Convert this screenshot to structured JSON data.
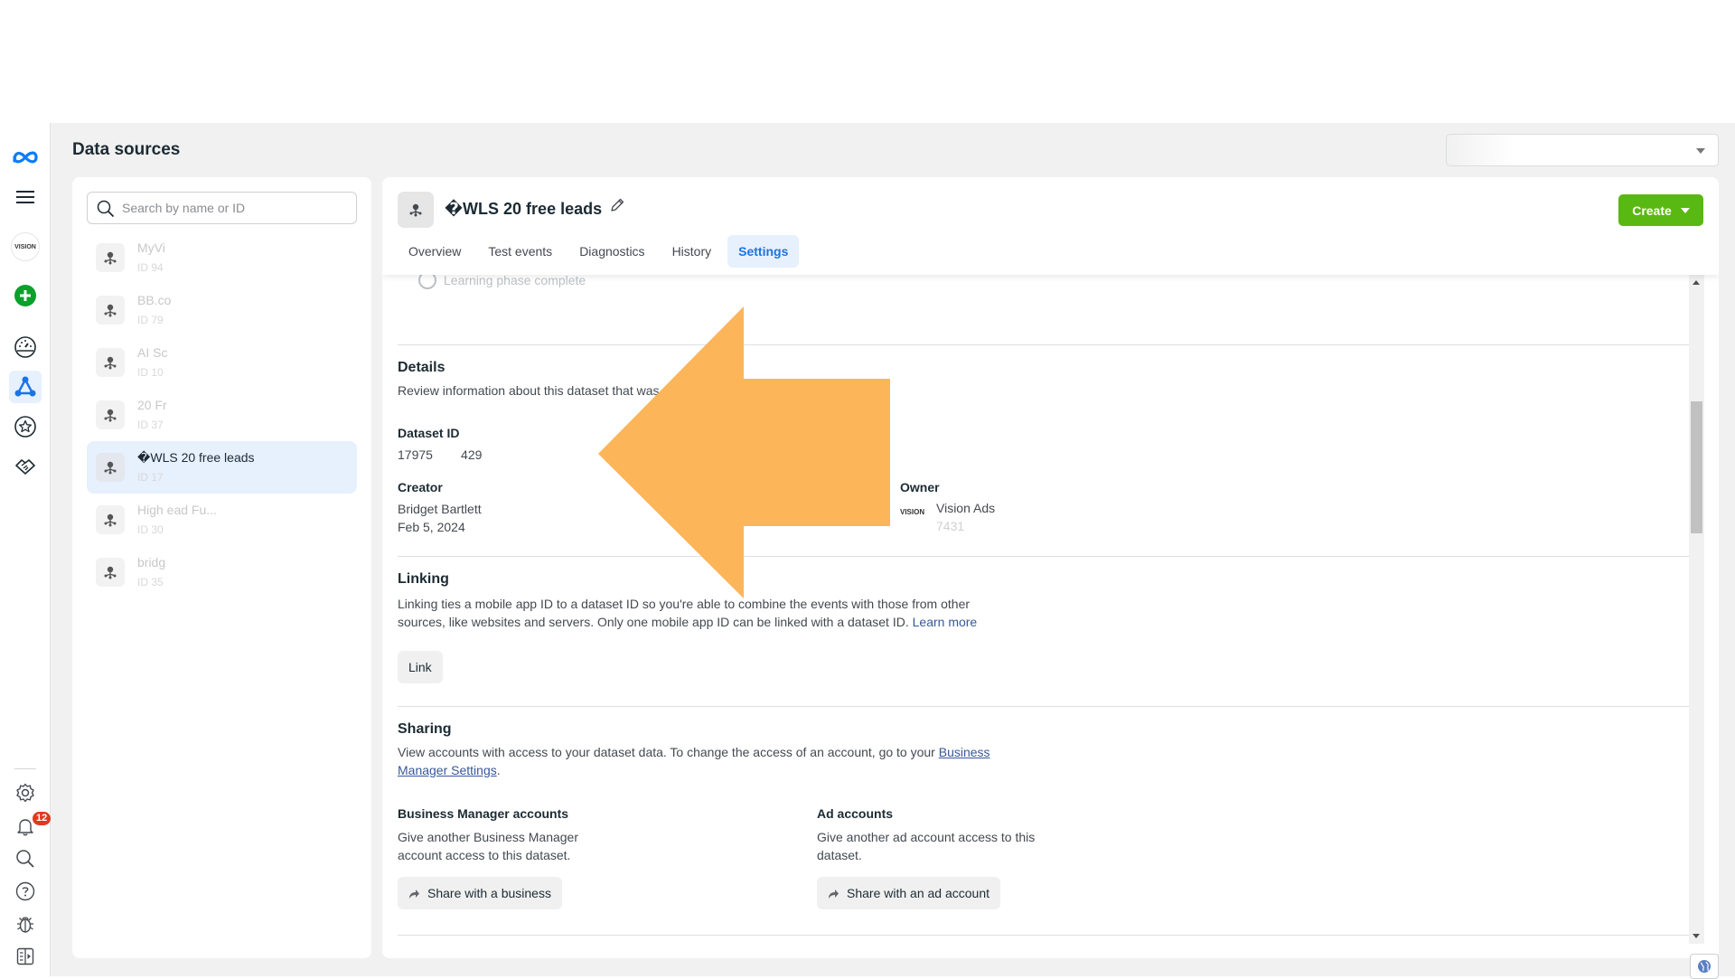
{
  "page": {
    "title": "Data sources"
  },
  "leftnav": {
    "account_logo_text": "VISION",
    "notifications_count": "12",
    "items": [
      {
        "name": "meta-logo"
      },
      {
        "name": "menu"
      },
      {
        "name": "account"
      },
      {
        "name": "create"
      },
      {
        "name": "dashboard"
      },
      {
        "name": "data-sources",
        "active": true
      },
      {
        "name": "favorites"
      },
      {
        "name": "partnerships"
      },
      {
        "name": "settings"
      },
      {
        "name": "notifications"
      },
      {
        "name": "search"
      },
      {
        "name": "help"
      },
      {
        "name": "report-bug"
      },
      {
        "name": "toggle-panel"
      }
    ]
  },
  "search": {
    "placeholder": "Search by name or ID",
    "value": ""
  },
  "datasets": [
    {
      "name": "MyVi",
      "id": "ID 94",
      "selected": false
    },
    {
      "name": "BB.co",
      "id": "ID 79",
      "selected": false
    },
    {
      "name": "AI Sc",
      "id": "ID 10",
      "selected": false
    },
    {
      "name": "20 Fr",
      "id": "ID 37",
      "selected": false
    },
    {
      "name": "�WLS 20 free leads",
      "id": "ID 17",
      "selected": true
    },
    {
      "name": "High                              ead Fu...",
      "id": "ID 30",
      "selected": false
    },
    {
      "name": "bridg",
      "id": "ID 35",
      "selected": false
    }
  ],
  "header": {
    "title": "�WLS 20 free leads",
    "create_label": "Create",
    "tabs": [
      {
        "label": "Overview",
        "active": false
      },
      {
        "label": "Test events",
        "active": false
      },
      {
        "label": "Diagnostics",
        "active": false
      },
      {
        "label": "History",
        "active": false
      },
      {
        "label": "Settings",
        "active": true
      }
    ]
  },
  "content": {
    "learning_phase": "Learning phase complete",
    "details": {
      "title": "Details",
      "description": "Review information about this dataset that was",
      "dataset_id_label": "Dataset ID",
      "dataset_id_value": "17975        429",
      "creator_label": "Creator",
      "creator_name": "Bridget Bartlett",
      "creator_date": "Feb 5, 2024",
      "owner_label": "Owner",
      "owner_logo_text": "VISION",
      "owner_name": "Vision Ads",
      "owner_id": "7431"
    },
    "linking": {
      "title": "Linking",
      "description": "Linking ties a mobile app ID to a dataset ID so you're able to combine the events with those from other sources, like websites and servers. Only one mobile app ID can be linked with a dataset ID.",
      "learn_more": "Learn more",
      "link_button": "Link"
    },
    "sharing": {
      "title": "Sharing",
      "description": "View accounts with access to your dataset data. To change the access of an account, go to your",
      "settings_link": "Business Manager Settings",
      "period": ".",
      "bm_title": "Business Manager accounts",
      "bm_description": "Give another Business Manager account access to this dataset.",
      "bm_button": "Share with a business",
      "ad_title": "Ad accounts",
      "ad_description": "Give another ad account access to this dataset.",
      "ad_button": "Share with an ad account"
    }
  },
  "annotation": {
    "type": "arrow",
    "direction": "left",
    "color": "#FDB55A"
  },
  "colors": {
    "brand_blue": "#1b74e4",
    "create_green": "#5ab812",
    "badge_red": "#e0391f",
    "selected_bg": "#e7f0fd"
  }
}
